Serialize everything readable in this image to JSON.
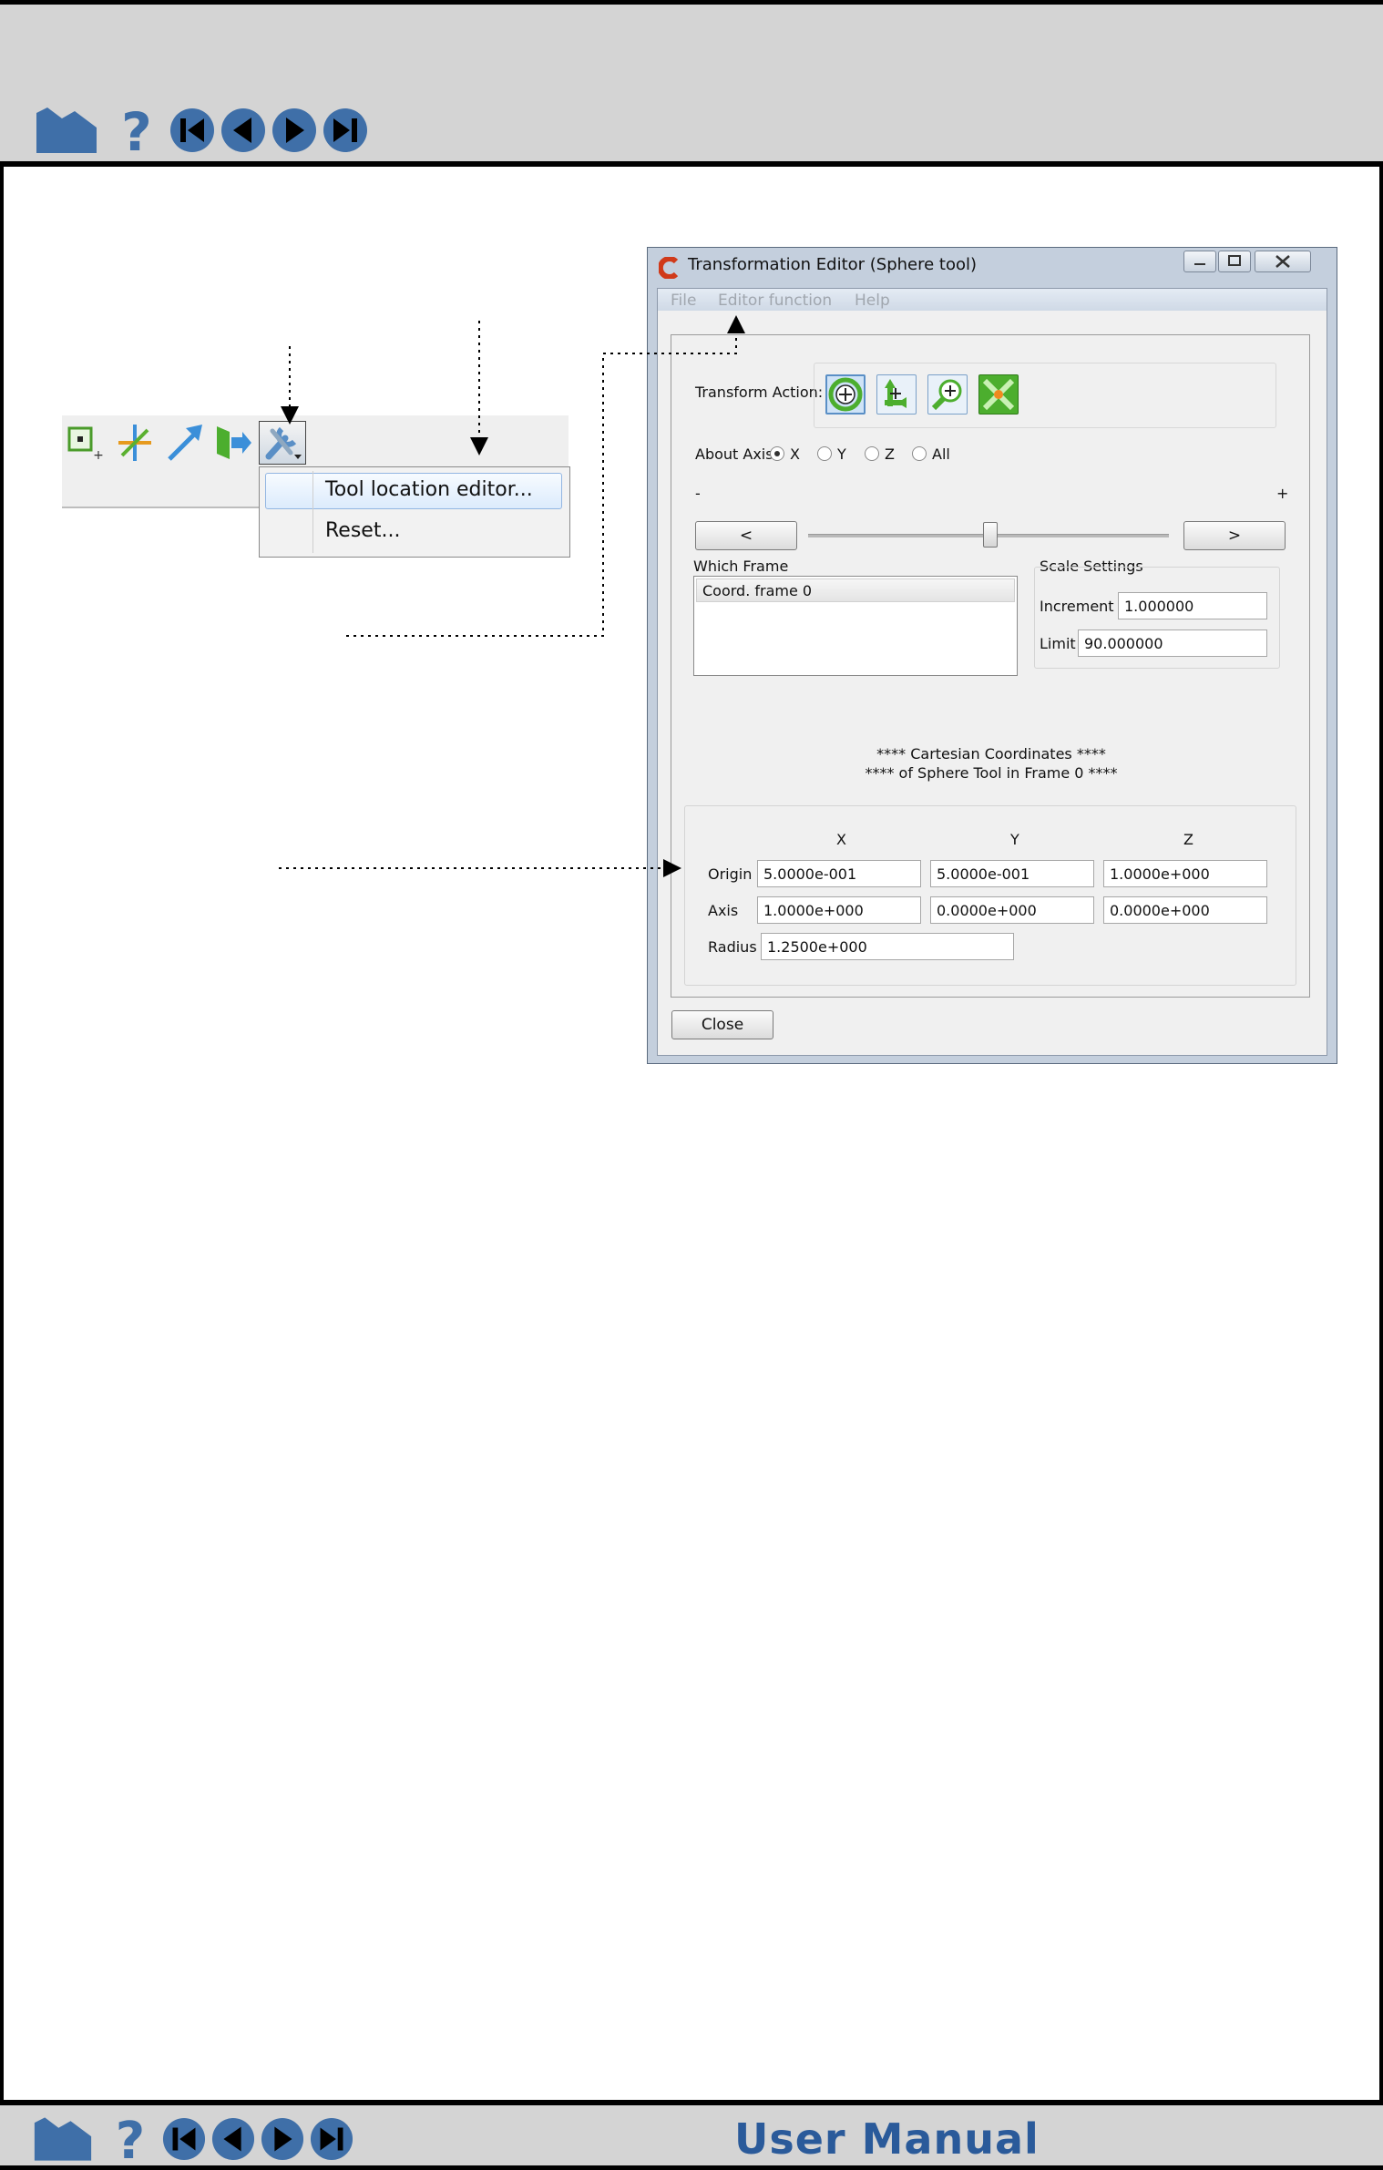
{
  "footer": {
    "title": "User Manual"
  },
  "toolbar_menu": {
    "items": [
      "Tool location editor...",
      "Reset..."
    ]
  },
  "window": {
    "title": "Transformation Editor (Sphere tool)",
    "menus": [
      "File",
      "Editor function",
      "Help"
    ],
    "transform_action_label": "Transform Action:",
    "about_axis_label": "About Axis:",
    "axis_options": [
      "X",
      "Y",
      "Z",
      "All"
    ],
    "axis_selected": "X",
    "minus_label": "-",
    "plus_label": "+",
    "decrement_button": "<",
    "increment_button": ">",
    "which_frame_label": "Which Frame",
    "frames": [
      "Coord. frame 0"
    ],
    "scale_settings_label": "Scale Settings",
    "increment_label": "Increment",
    "increment_value": "1.000000",
    "limit_label": "Limit",
    "limit_value": "90.000000",
    "coords_heading_1": "**** Cartesian Coordinates ****",
    "coords_heading_2": "**** of Sphere Tool in Frame 0 ****",
    "col_headers": [
      "X",
      "Y",
      "Z"
    ],
    "rows": [
      {
        "label": "Origin",
        "values": [
          "5.0000e-001",
          "5.0000e-001",
          "1.0000e+000"
        ]
      },
      {
        "label": "Axis",
        "values": [
          "1.0000e+000",
          "0.0000e+000",
          "0.0000e+000"
        ]
      }
    ],
    "radius_label": "Radius",
    "radius_value": "1.2500e+000",
    "close_button": "Close"
  },
  "colors": {
    "nav_blue": "#3f6fa8",
    "title_blue": "#2a5a9a",
    "action_green": "#4cae2e"
  }
}
